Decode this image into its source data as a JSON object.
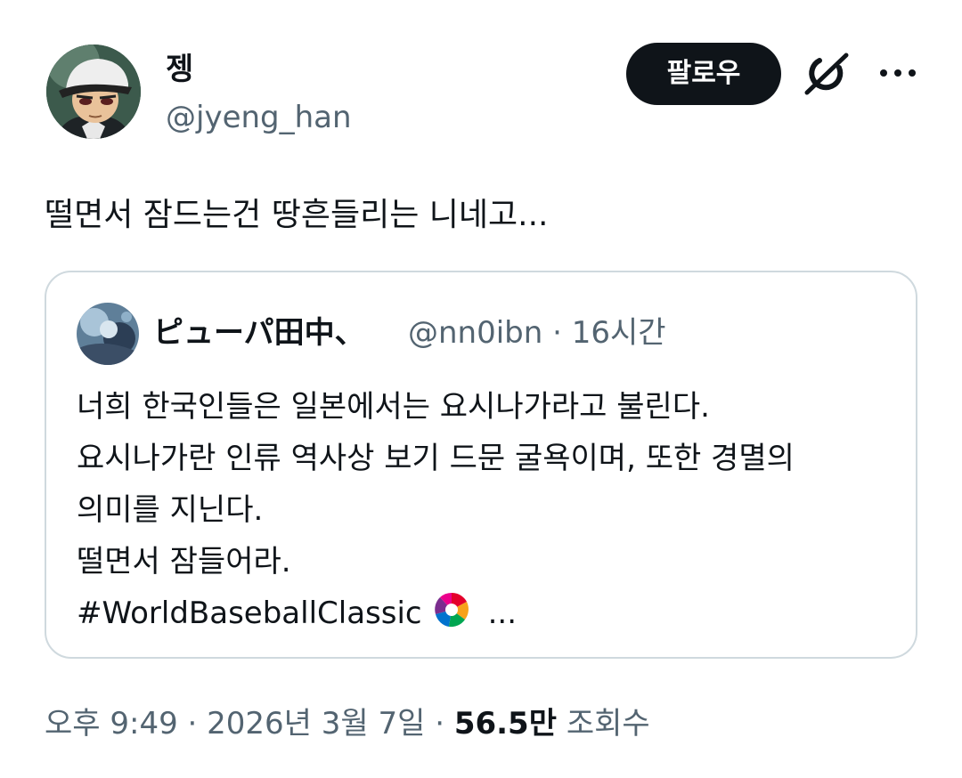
{
  "author": {
    "display_name": "젱",
    "handle": "@jyeng_han",
    "avatar_icon": "avatar-cartoon-boy-cap"
  },
  "actions": {
    "follow_label": "팔로우",
    "grok_icon": "grok-icon",
    "more_icon": "more-icon"
  },
  "tweet": {
    "text": "떨면서 잠드는건 땅흔들리는 니네고..."
  },
  "quote": {
    "display_name": "ピューパ田中、",
    "handle": "@nn0ibn",
    "separator": "·",
    "time": "16시간",
    "lines": [
      "너희 한국인들은 일본에서는 요시나가라고 불린다.",
      "요시나가란 인류 역사상 보기 드문 굴욕이며, 또한 경멸의",
      "의미를 지닌다.",
      "떨면서 잠들어라.",
      "#WorldBaseballClassic"
    ],
    "emoji_icon": "wbc-logo-icon",
    "ellipsis": "..."
  },
  "footer": {
    "timestamp": "오후 9:49 · 2026년 3월 7일 ·",
    "views_count": "56.5만",
    "views_label": "조회수"
  },
  "colors": {
    "text_primary": "#0f1419",
    "text_secondary": "#536471",
    "border": "#cfd9de",
    "button_bg": "#0f1419"
  }
}
